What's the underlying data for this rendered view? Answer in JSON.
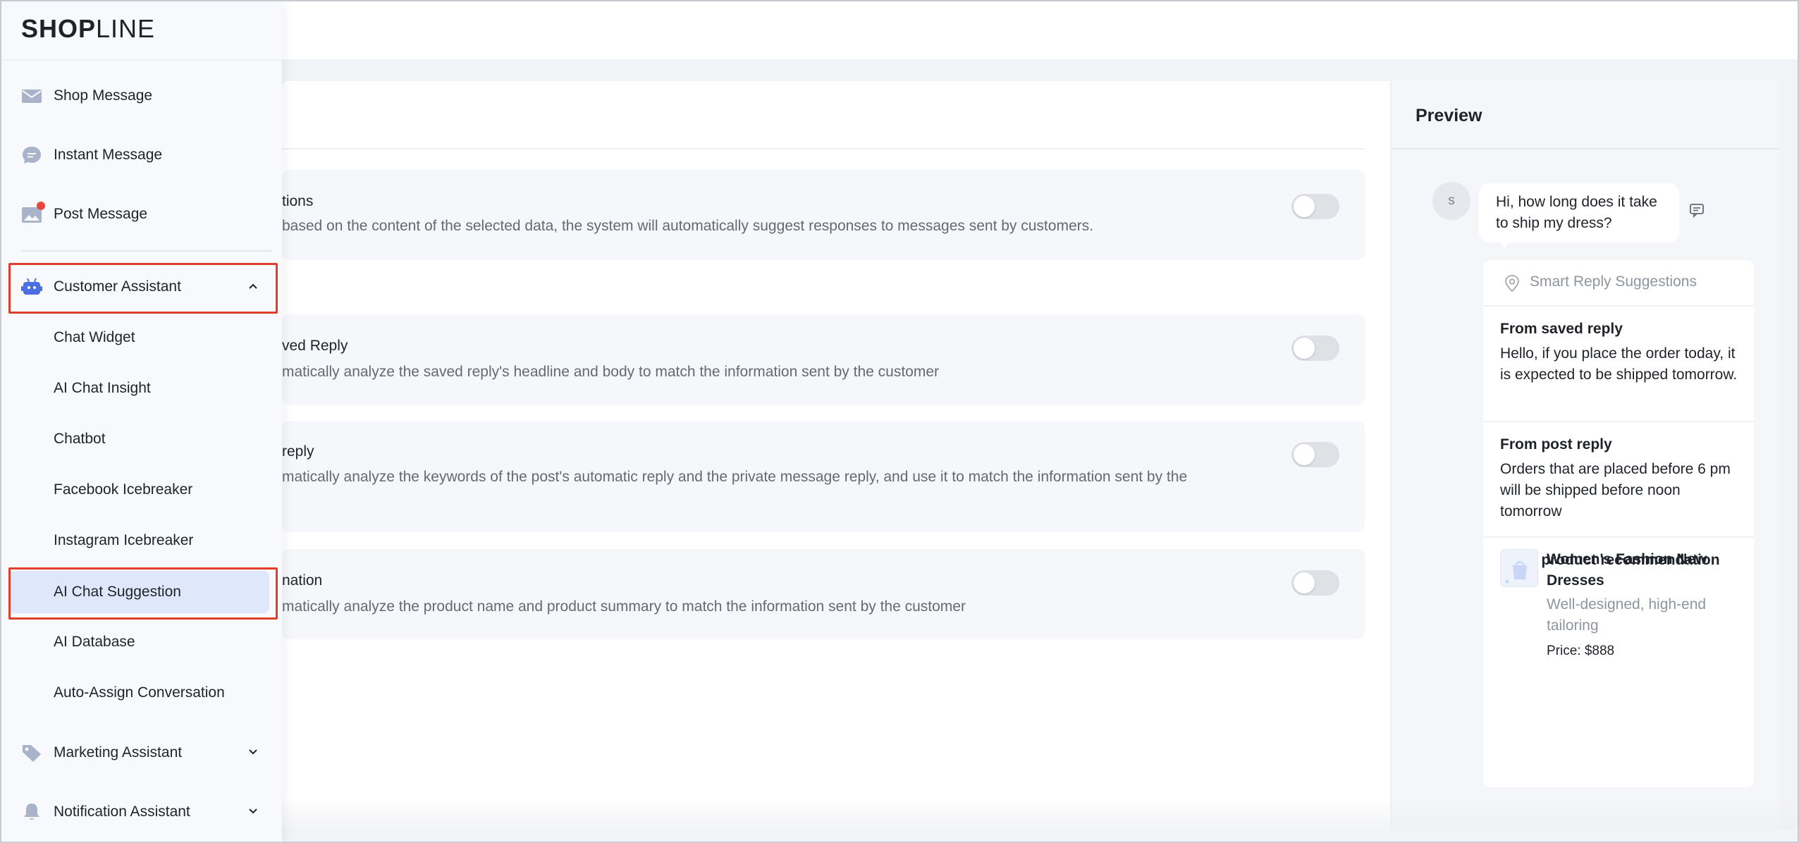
{
  "brand": {
    "logo_text_bold": "SHOP",
    "logo_text_light": "LINE"
  },
  "sidebar": {
    "top_items": [
      {
        "label": "Shop Message",
        "icon": "envelope-icon"
      },
      {
        "label": "Instant Message",
        "icon": "chat-bubble-icon"
      },
      {
        "label": "Post Message",
        "icon": "image-post-icon",
        "has_badge": true
      }
    ],
    "customer_assistant": {
      "label": "Customer Assistant",
      "icon": "robot-icon",
      "expanded": true,
      "sub_items": [
        {
          "label": "Chat Widget"
        },
        {
          "label": "AI Chat Insight"
        },
        {
          "label": "Chatbot"
        },
        {
          "label": "Facebook Icebreaker"
        },
        {
          "label": "Instagram Icebreaker"
        },
        {
          "label": "AI Chat Suggestion",
          "active": true
        },
        {
          "label": "AI Database"
        },
        {
          "label": "Auto-Assign Conversation"
        }
      ]
    },
    "marketing_assistant": {
      "label": "Marketing Assistant",
      "icon": "tag-icon"
    },
    "notification_assistant": {
      "label": "Notification Assistant",
      "icon": "bell-icon"
    }
  },
  "settings": [
    {
      "title_partial": "tions",
      "desc_partial": "based on the content of the selected data, the system will automatically suggest responses to messages sent by customers.",
      "enabled": false
    },
    {
      "title_partial": "ved Reply",
      "desc_partial": "matically analyze the saved reply's headline and body to match the information sent by the customer",
      "enabled": false
    },
    {
      "title_partial": "reply",
      "desc_partial": "matically analyze the keywords of the post's automatic reply and the private message reply, and use it to match the information sent by the",
      "enabled": false
    },
    {
      "title_partial": "nation",
      "desc_partial": "matically analyze the product name and product summary to match the information sent by the customer",
      "enabled": false
    }
  ],
  "preview": {
    "title": "Preview",
    "customer_avatar_letter": "s",
    "customer_message": "Hi, how long does it take to ship my dress?",
    "suggestions_header": "Smart Reply Suggestions",
    "saved_reply": {
      "title": "From saved reply",
      "text": "Hello, if you place the order today, it is expected to be shipped tomorrow."
    },
    "post_reply": {
      "title": "From post reply",
      "text": "Orders that are placed before 6 pm will be shipped before noon tomorrow"
    },
    "product_recommendation": {
      "title": "From product recommendation",
      "product_name": "Women's Fashion New Dresses",
      "product_desc": "Well-designed, high-end tailoring",
      "price": "Price: $888"
    }
  },
  "colors": {
    "accent_blue": "#4a6fe3",
    "active_bg": "#dfe7fa",
    "highlight_red": "#e0402b",
    "badge_red": "#e8483b"
  }
}
